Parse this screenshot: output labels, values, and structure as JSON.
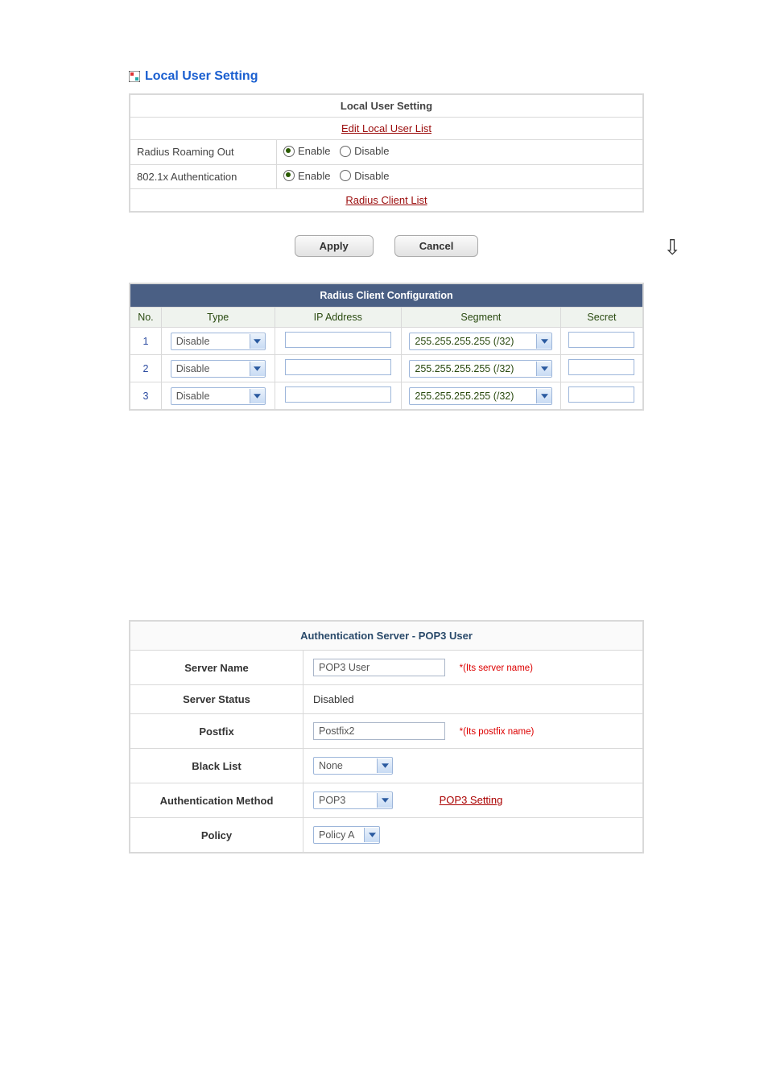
{
  "header": {
    "title": "Local User Setting"
  },
  "panel": {
    "title": "Local User Setting",
    "edit_link": "Edit Local User List",
    "rows": [
      {
        "label": "Radius Roaming Out",
        "opt_enable": "Enable",
        "opt_disable": "Disable",
        "selected": "enable"
      },
      {
        "label": "802.1x Authentication",
        "opt_enable": "Enable",
        "opt_disable": "Disable",
        "selected": "enable"
      }
    ],
    "client_list_link": "Radius Client List"
  },
  "buttons": {
    "apply": "Apply",
    "cancel": "Cancel"
  },
  "grid": {
    "title": "Radius Client Configuration",
    "cols": {
      "no": "No.",
      "type": "Type",
      "ip": "IP Address",
      "segment": "Segment",
      "secret": "Secret"
    },
    "rows": [
      {
        "no": "1",
        "type": "Disable",
        "ip": "",
        "segment": "255.255.255.255 (/32)",
        "secret": ""
      },
      {
        "no": "2",
        "type": "Disable",
        "ip": "",
        "segment": "255.255.255.255 (/32)",
        "secret": ""
      },
      {
        "no": "3",
        "type": "Disable",
        "ip": "",
        "segment": "255.255.255.255 (/32)",
        "secret": ""
      }
    ]
  },
  "form": {
    "title": "Authentication Server - POP3 User",
    "server_name": {
      "label": "Server Name",
      "value": "POP3 User",
      "hint": "*(Its server name)"
    },
    "server_status": {
      "label": "Server Status",
      "value": "Disabled"
    },
    "postfix": {
      "label": "Postfix",
      "value": "Postfix2",
      "hint": "*(Its postfix name)"
    },
    "black_list": {
      "label": "Black List",
      "value": "None"
    },
    "auth_method": {
      "label": "Authentication Method",
      "value": "POP3",
      "link": "POP3 Setting"
    },
    "policy": {
      "label": "Policy",
      "value": "Policy A"
    }
  }
}
